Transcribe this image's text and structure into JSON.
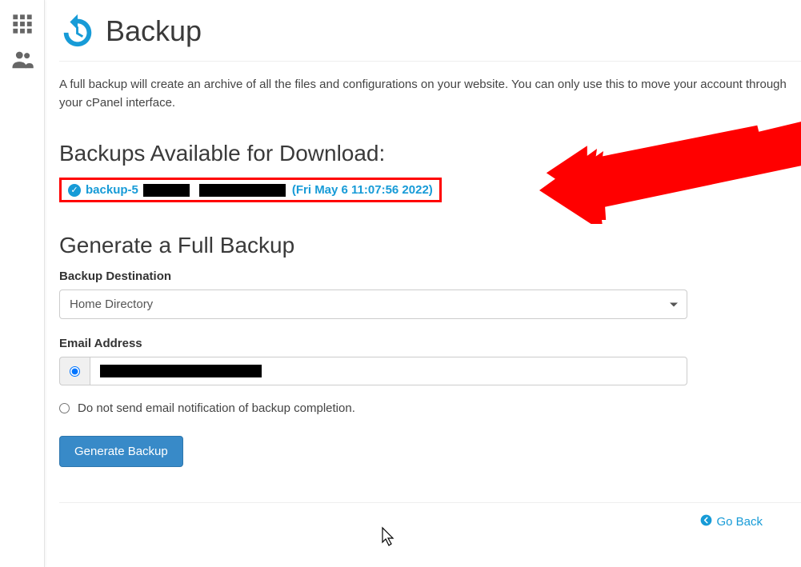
{
  "page": {
    "title": "Backup",
    "intro": "A full backup will create an archive of all the files and configurations on your website. You can only use this to move your account through your cPanel interface."
  },
  "available": {
    "heading": "Backups Available for Download:",
    "link_prefix": "backup-5",
    "link_date": "(Fri May 6 11:07:56 2022)"
  },
  "generate": {
    "heading": "Generate a Full Backup",
    "dest_label": "Backup Destination",
    "dest_value": "Home Directory",
    "email_label": "Email Address",
    "no_email_label": "Do not send email notification of backup completion.",
    "button": "Generate Backup"
  },
  "footer": {
    "go_back": "Go Back"
  }
}
